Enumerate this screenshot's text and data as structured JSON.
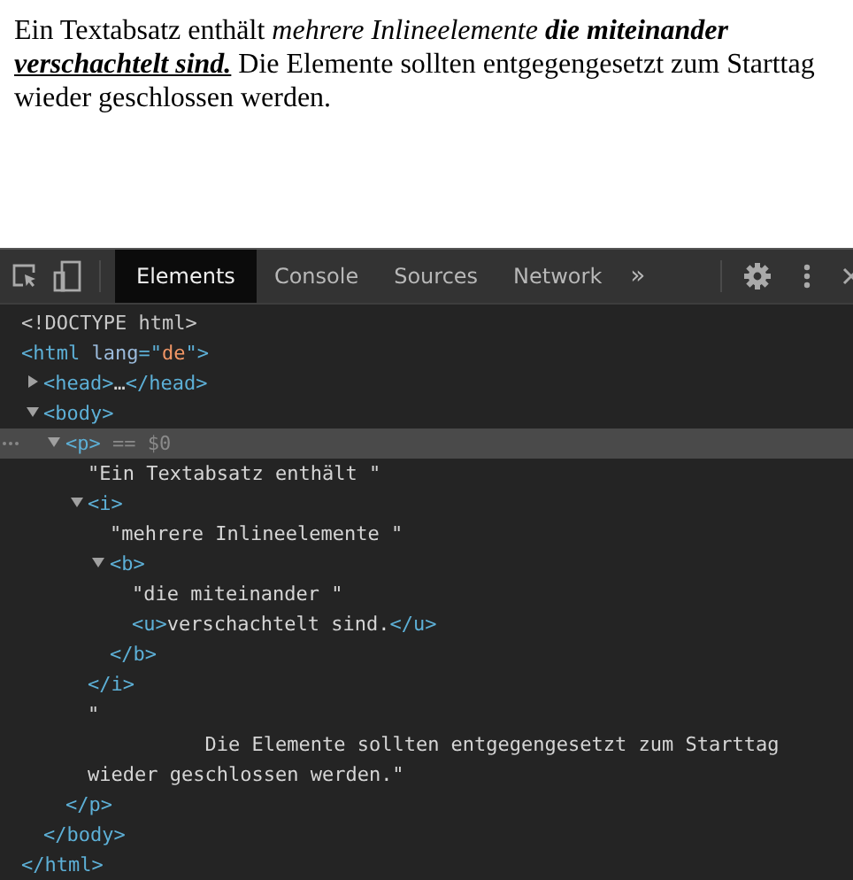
{
  "page": {
    "paragraph": [
      {
        "text": "Ein Textabsatz enthält ",
        "italic": false,
        "bold": false,
        "underline": false
      },
      {
        "text": "mehrere Inlineelemente ",
        "italic": true,
        "bold": false,
        "underline": false
      },
      {
        "text": "die miteinander ",
        "italic": true,
        "bold": true,
        "underline": false
      },
      {
        "text": "verschachtelt sind.",
        "italic": true,
        "bold": true,
        "underline": true
      },
      {
        "text": " Die Elemente sollten entgegengesetzt zum Starttag wieder geschlossen werden.",
        "italic": false,
        "bold": false,
        "underline": false
      }
    ]
  },
  "devtools": {
    "tabs": [
      {
        "label": "Elements",
        "selected": true
      },
      {
        "label": "Console",
        "selected": false
      },
      {
        "label": "Sources",
        "selected": false
      },
      {
        "label": "Network",
        "selected": false
      }
    ],
    "more_tabs": "»",
    "tree": [
      {
        "kind": "doctype",
        "text": "<!DOCTYPE html>"
      },
      {
        "kind": "element",
        "open": [
          {
            "kind": "tag",
            "text": "<html "
          },
          {
            "kind": "attr",
            "text": "lang"
          },
          {
            "kind": "tag",
            "text": "=\""
          },
          {
            "kind": "value",
            "text": "de"
          },
          {
            "kind": "tag",
            "text": "\">"
          }
        ],
        "selected": false,
        "close": "</html>",
        "children": [
          {
            "kind": "element",
            "open": [
              {
                "kind": "tag",
                "text": "<head>"
              },
              {
                "kind": "plain",
                "text": "…"
              },
              {
                "kind": "tag",
                "text": "</head>"
              }
            ],
            "expanded": false,
            "selected": false
          },
          {
            "kind": "element",
            "open": [
              {
                "kind": "tag",
                "text": "<body>"
              }
            ],
            "expanded": true,
            "selected": false,
            "close": "</body>",
            "children": [
              {
                "kind": "element",
                "open": [
                  {
                    "kind": "tag",
                    "text": "<p>"
                  }
                ],
                "note": " == $0",
                "expanded": true,
                "selected": true,
                "close": "</p>",
                "children": [
                  {
                    "kind": "text",
                    "text": "\"Ein Textabsatz enthält \""
                  },
                  {
                    "kind": "element",
                    "open": [
                      {
                        "kind": "tag",
                        "text": "<i>"
                      }
                    ],
                    "expanded": true,
                    "selected": false,
                    "close": "</i>",
                    "children": [
                      {
                        "kind": "text",
                        "text": "\"mehrere Inlineelemente \""
                      },
                      {
                        "kind": "element",
                        "open": [
                          {
                            "kind": "tag",
                            "text": "<b>"
                          }
                        ],
                        "expanded": true,
                        "selected": false,
                        "close": "</b>",
                        "children": [
                          {
                            "kind": "text",
                            "text": "\"die miteinander \""
                          },
                          {
                            "kind": "element",
                            "open": [
                              {
                                "kind": "tag",
                                "text": "<u>"
                              },
                              {
                                "kind": "plain",
                                "text": "verschachtelt sind."
                              },
                              {
                                "kind": "tag",
                                "text": "</u>"
                              }
                            ],
                            "selected": false
                          }
                        ]
                      }
                    ]
                  },
                  {
                    "kind": "text",
                    "text": "\"\n          Die Elemente sollten entgegengesetzt zum Starttag wieder geschlossen werden.\""
                  }
                ]
              }
            ]
          }
        ]
      }
    ]
  }
}
